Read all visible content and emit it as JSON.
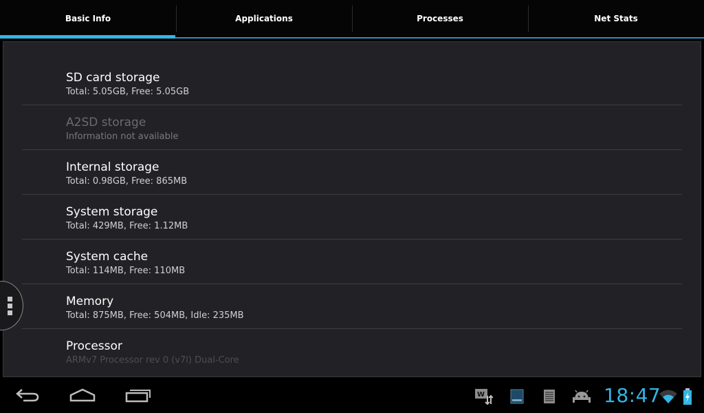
{
  "tabs": [
    {
      "label": "Basic Info",
      "active": true
    },
    {
      "label": "Applications",
      "active": false
    },
    {
      "label": "Processes",
      "active": false
    },
    {
      "label": "Net Stats",
      "active": false
    }
  ],
  "items": [
    {
      "title": "SD card storage",
      "subtitle": "Total: 5.05GB, Free: 5.05GB"
    },
    {
      "title": "A2SD storage",
      "subtitle": "Information not available"
    },
    {
      "title": "Internal storage",
      "subtitle": "Total: 0.98GB, Free: 865MB"
    },
    {
      "title": "System storage",
      "subtitle": "Total: 429MB, Free: 1.12MB"
    },
    {
      "title": "System cache",
      "subtitle": "Total: 114MB, Free: 110MB"
    },
    {
      "title": "Memory",
      "subtitle": "Total: 875MB, Free: 504MB, Idle: 235MB"
    },
    {
      "title": "Processor",
      "subtitle": "ARMv7 Processor rev 0 (v7l) Dual-Core"
    }
  ],
  "statusbar": {
    "clock": "18:47",
    "icons": [
      "usb-debug-icon",
      "sd-card-icon",
      "notes-icon",
      "android-debug-icon",
      "wifi-icon",
      "battery-charging-icon"
    ]
  },
  "navbar": {
    "buttons": [
      "back-icon",
      "home-icon",
      "recent-apps-icon"
    ]
  },
  "colors": {
    "accent": "#33b5e5",
    "panel": "#222226",
    "divider": "#3e3e42"
  }
}
